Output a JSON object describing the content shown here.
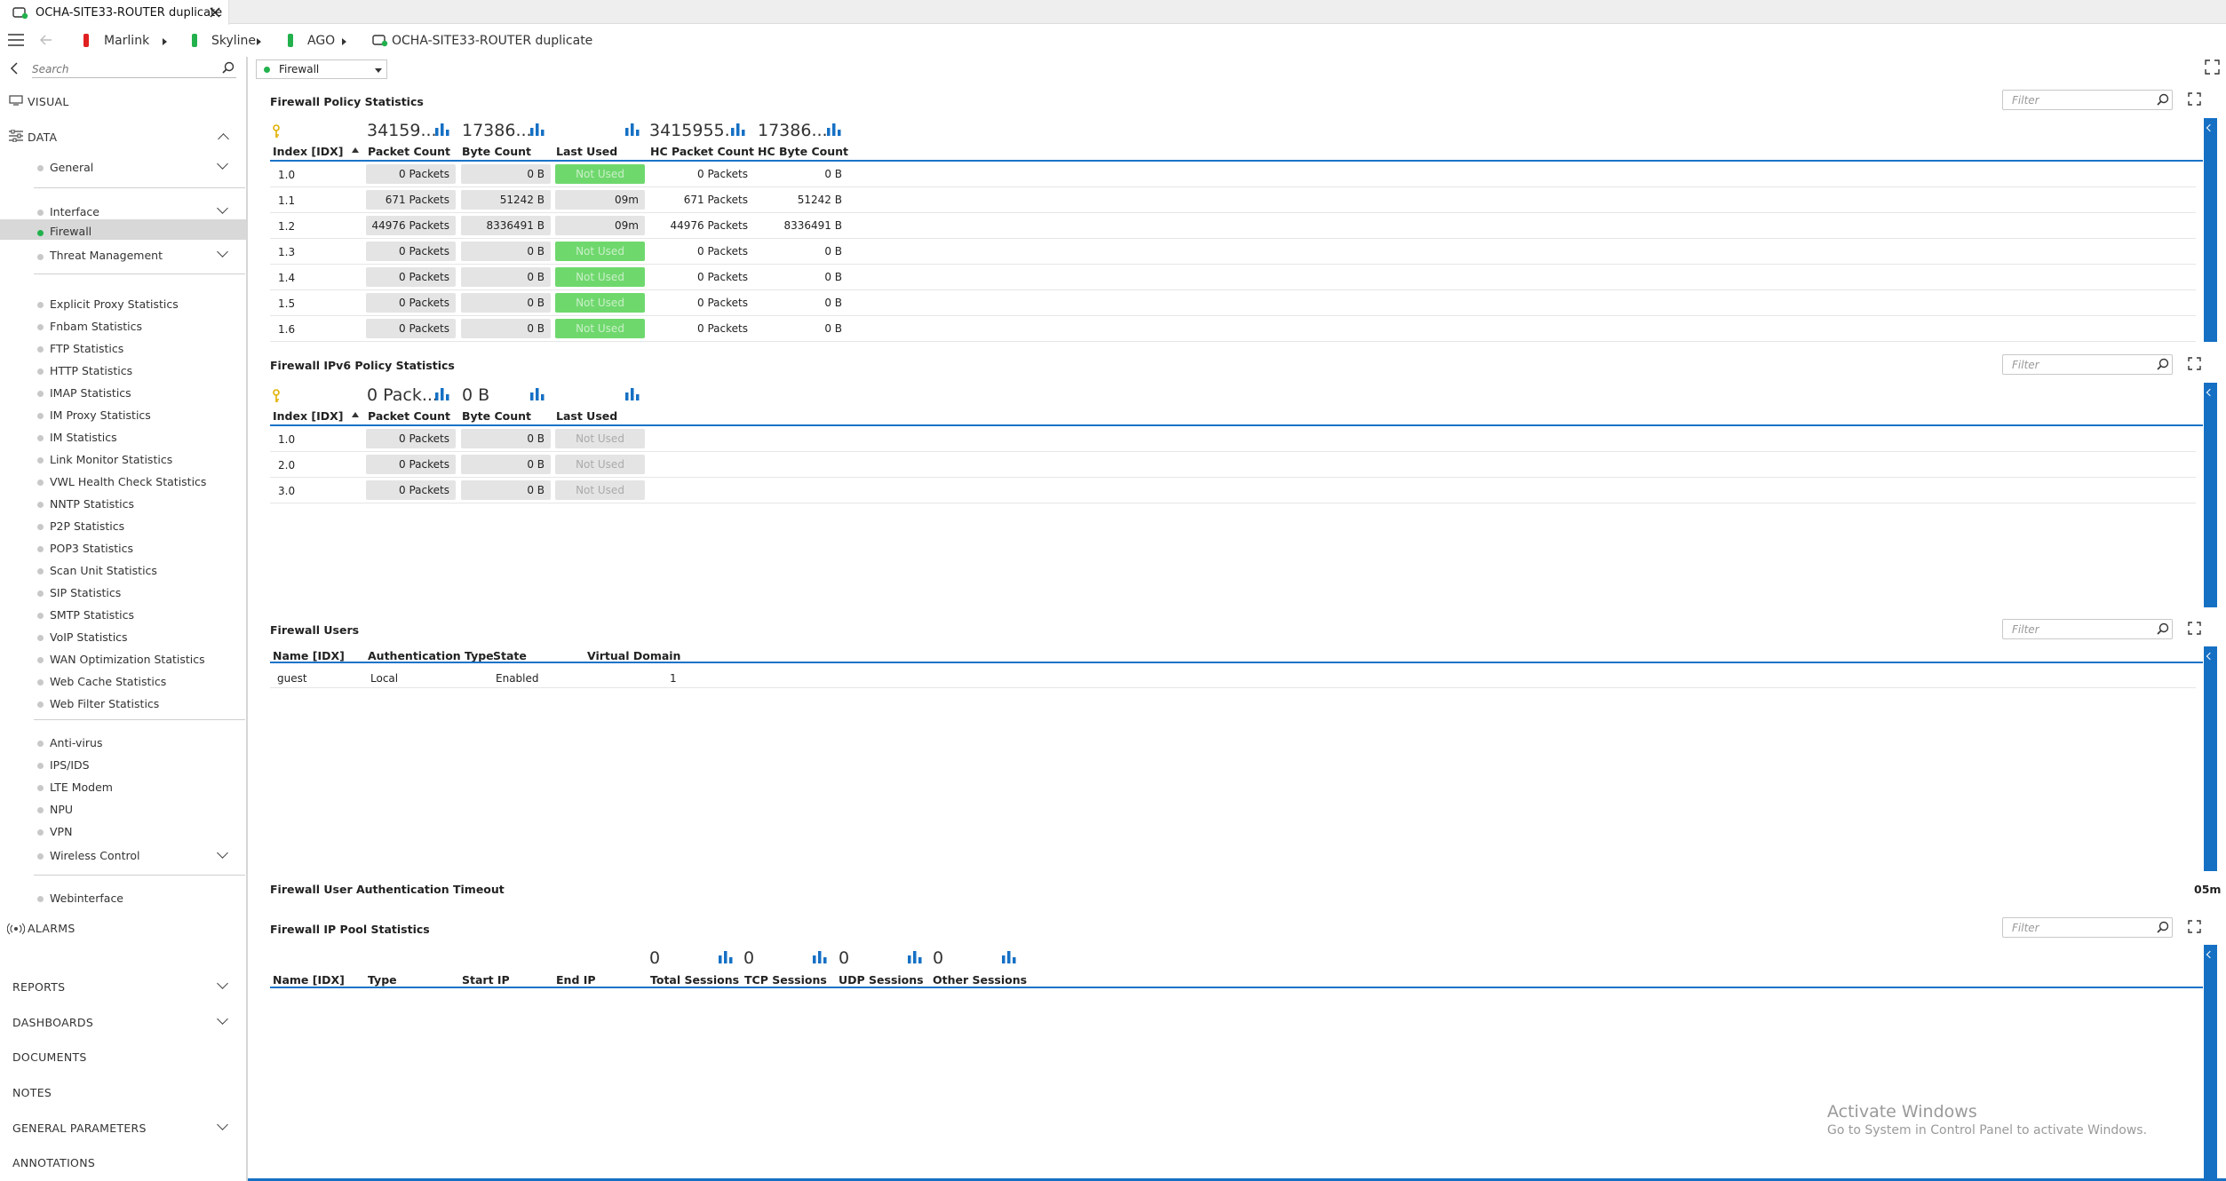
{
  "window": {
    "tab_title": "OCHA-SITE33-ROUTER duplicate"
  },
  "breadcrumb": [
    {
      "label": "Marlink",
      "color": "#e02020"
    },
    {
      "label": "Skyline",
      "color": "#22b14c"
    },
    {
      "label": "AGO",
      "color": "#22b14c"
    },
    {
      "label": "OCHA-SITE33-ROUTER duplicate"
    }
  ],
  "sidebar": {
    "search_placeholder": "Search",
    "visual_label": "VISUAL",
    "data_label": "DATA",
    "groups": [
      {
        "items": [
          "General"
        ]
      },
      {
        "items": [
          "Interface",
          "Firewall",
          "Threat Management"
        ]
      },
      {
        "items": [
          "Explicit Proxy Statistics",
          "Fnbam Statistics",
          "FTP Statistics",
          "HTTP Statistics",
          "IMAP Statistics",
          "IM Proxy Statistics",
          "IM Statistics",
          "Link Monitor Statistics",
          "VWL Health Check Statistics",
          "NNTP Statistics",
          "P2P Statistics",
          "POP3 Statistics",
          "Scan Unit Statistics",
          "SIP Statistics",
          "SMTP Statistics",
          "VoIP Statistics",
          "WAN Optimization Statistics",
          "Web Cache Statistics",
          "Web Filter Statistics"
        ]
      },
      {
        "items": [
          "Anti-virus",
          "IPS/IDS",
          "LTE Modem",
          "NPU",
          "VPN",
          "Wireless Control"
        ]
      },
      {
        "items": [
          "Webinterface"
        ]
      }
    ],
    "active_item": "Firewall",
    "alarms_label": "ALARMS",
    "bottom": [
      "REPORTS",
      "DASHBOARDS",
      "DOCUMENTS",
      "NOTES",
      "GENERAL PARAMETERS",
      "ANNOTATIONS"
    ]
  },
  "page_select": {
    "value": "Firewall",
    "status_color": "#22b14c"
  },
  "filter_placeholder": "Filter",
  "policy": {
    "title": "Firewall Policy Statistics",
    "totals": [
      "34159...",
      "17386...",
      "3415955...",
      "17386..."
    ],
    "headers": [
      "Index [IDX]",
      "Packet Count",
      "Byte Count",
      "Last Used",
      "HC Packet Count",
      "HC Byte Count"
    ],
    "rows": [
      {
        "idx": "1.0",
        "pkt": "0 Packets",
        "byte": "0 B",
        "last": "Not Used",
        "hcpkt": "0 Packets",
        "hcbyte": "0 B"
      },
      {
        "idx": "1.1",
        "pkt": "671 Packets",
        "byte": "51242 B",
        "last": "09m",
        "hcpkt": "671 Packets",
        "hcbyte": "51242 B"
      },
      {
        "idx": "1.2",
        "pkt": "44976 Packets",
        "byte": "8336491 B",
        "last": "09m",
        "hcpkt": "44976 Packets",
        "hcbyte": "8336491 B"
      },
      {
        "idx": "1.3",
        "pkt": "0 Packets",
        "byte": "0 B",
        "last": "Not Used",
        "hcpkt": "0 Packets",
        "hcbyte": "0 B"
      },
      {
        "idx": "1.4",
        "pkt": "0 Packets",
        "byte": "0 B",
        "last": "Not Used",
        "hcpkt": "0 Packets",
        "hcbyte": "0 B"
      },
      {
        "idx": "1.5",
        "pkt": "0 Packets",
        "byte": "0 B",
        "last": "Not Used",
        "hcpkt": "0 Packets",
        "hcbyte": "0 B"
      },
      {
        "idx": "1.6",
        "pkt": "0 Packets",
        "byte": "0 B",
        "last": "Not Used",
        "hcpkt": "0 Packets",
        "hcbyte": "0 B"
      }
    ]
  },
  "ipv6": {
    "title": "Firewall IPv6 Policy Statistics",
    "totals": [
      "0 Pack...",
      "0 B"
    ],
    "headers": [
      "Index [IDX]",
      "Packet Count",
      "Byte Count",
      "Last Used"
    ],
    "rows": [
      {
        "idx": "1.0",
        "pkt": "0 Packets",
        "byte": "0 B",
        "last": "Not Used"
      },
      {
        "idx": "2.0",
        "pkt": "0 Packets",
        "byte": "0 B",
        "last": "Not Used"
      },
      {
        "idx": "3.0",
        "pkt": "0 Packets",
        "byte": "0 B",
        "last": "Not Used"
      }
    ]
  },
  "users": {
    "title": "Firewall Users",
    "headers": [
      "Name [IDX]",
      "Authentication Type",
      "State",
      "Virtual Domain"
    ],
    "rows": [
      {
        "name": "guest",
        "auth": "Local",
        "state": "Enabled",
        "vdom": "1"
      }
    ]
  },
  "timeout": {
    "title": "Firewall User Authentication Timeout",
    "value": "05m"
  },
  "ippool": {
    "title": "Firewall IP Pool Statistics",
    "totals": [
      "0",
      "0",
      "0",
      "0"
    ],
    "headers": [
      "Name [IDX]",
      "Type",
      "Start IP",
      "End IP",
      "Total Sessions",
      "TCP Sessions",
      "UDP Sessions",
      "Other Sessions"
    ]
  },
  "watermark": {
    "line1": "Activate Windows",
    "line2": "Go to System in Control Panel to activate Windows."
  },
  "colors": {
    "accent": "#1570c4",
    "ok_green": "#6fd86d"
  }
}
